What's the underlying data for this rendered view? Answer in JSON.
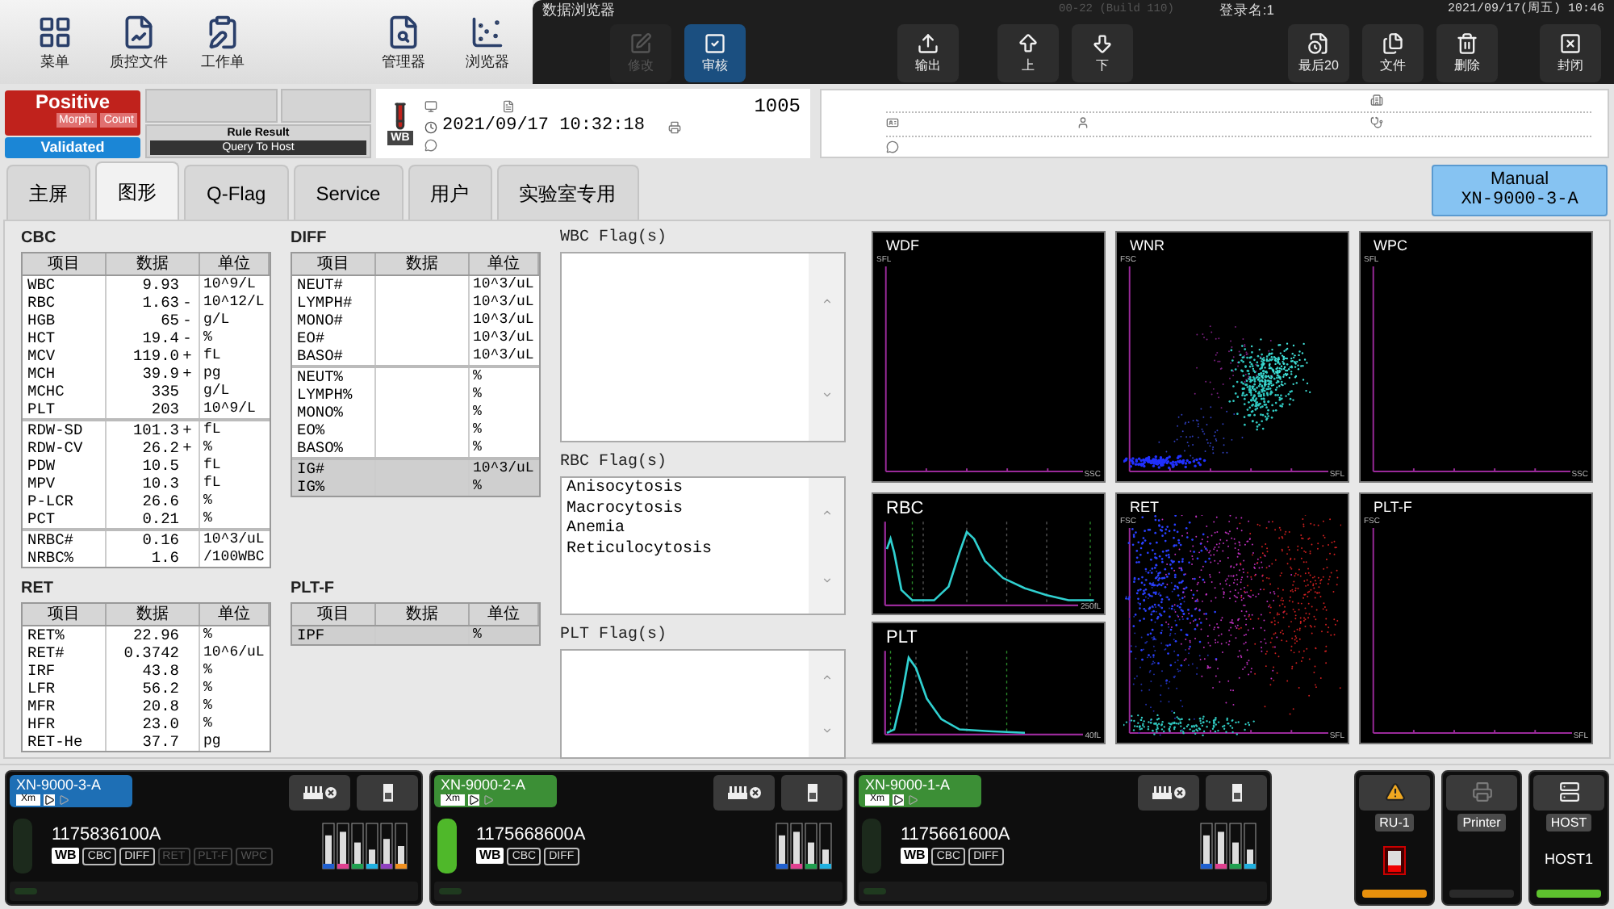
{
  "toolbar": [
    {
      "label": "菜单"
    },
    {
      "label": "质控文件"
    },
    {
      "label": "工作单"
    },
    {
      "label": "管理器"
    },
    {
      "label": "浏览器"
    }
  ],
  "browser": {
    "title": "数据浏览器",
    "build": "00-22 (Build 110)",
    "login": "登录名:1",
    "datetime": "2021/09/17(周五) 10:46",
    "groups": [
      [
        {
          "label": "修改",
          "disabled": true,
          "selected": false
        },
        {
          "label": "审核",
          "disabled": false,
          "selected": true
        }
      ],
      [
        {
          "label": "输出",
          "disabled": false,
          "selected": false
        }
      ],
      [
        {
          "label": "上",
          "disabled": false,
          "selected": false
        },
        {
          "label": "下",
          "disabled": false,
          "selected": false
        }
      ],
      [
        {
          "label": "最后20",
          "disabled": false,
          "selected": false
        },
        {
          "label": "文件",
          "disabled": false,
          "selected": false
        },
        {
          "label": "删除",
          "disabled": false,
          "selected": false
        }
      ],
      [
        {
          "label": "封闭",
          "disabled": false,
          "selected": false
        }
      ]
    ]
  },
  "status": {
    "result": "Positive",
    "tags": [
      "Morph.",
      "Count"
    ],
    "validation": "Validated",
    "rule_title": "Rule Result",
    "rule_value": "Query To Host"
  },
  "sample": {
    "type": "WB",
    "number": "1005",
    "datetime": "2021/09/17 10:32:18"
  },
  "tabs": [
    {
      "label": "主屏",
      "selected": false
    },
    {
      "label": "图形",
      "selected": true
    },
    {
      "label": "Q-Flag",
      "selected": false
    },
    {
      "label": "Service",
      "selected": false
    },
    {
      "label": "用户",
      "selected": false
    },
    {
      "label": "实验室专用",
      "selected": false
    }
  ],
  "mode_button": {
    "line1": "Manual",
    "line2": "XN-9000-3-A"
  },
  "left_tables": [
    {
      "title": "CBC",
      "columns": [
        "项目",
        "数据",
        "单位"
      ],
      "groups": [
        [
          {
            "item": "WBC",
            "value": "9.93",
            "unit": "10^9/L",
            "greyed": false
          },
          {
            "item": "RBC",
            "value": "1.63",
            "flag": "-",
            "unit": "10^12/L",
            "greyed": false
          },
          {
            "item": "HGB",
            "value": "65",
            "flag": "-",
            "unit": "g/L",
            "greyed": false
          },
          {
            "item": "HCT",
            "value": "19.4",
            "flag": "-",
            "unit": "%",
            "greyed": false
          },
          {
            "item": "MCV",
            "value": "119.0",
            "flag": "+",
            "unit": "fL",
            "greyed": false
          },
          {
            "item": "MCH",
            "value": "39.9",
            "flag": "+",
            "unit": "pg",
            "greyed": false
          },
          {
            "item": "MCHC",
            "value": "335",
            "unit": "g/L",
            "greyed": false
          },
          {
            "item": "PLT",
            "value": "203",
            "unit": "10^9/L",
            "greyed": false
          }
        ],
        [
          {
            "item": "RDW-SD",
            "value": "101.3",
            "flag": "+",
            "unit": "fL",
            "greyed": false
          },
          {
            "item": "RDW-CV",
            "value": "26.2",
            "flag": "+",
            "unit": "%",
            "greyed": false
          },
          {
            "item": "PDW",
            "value": "10.5",
            "unit": "fL",
            "greyed": false
          },
          {
            "item": "MPV",
            "value": "10.3",
            "unit": "fL",
            "greyed": false
          },
          {
            "item": "P-LCR",
            "value": "26.6",
            "unit": "%",
            "greyed": false
          },
          {
            "item": "PCT",
            "value": "0.21",
            "unit": "%",
            "greyed": false
          }
        ],
        [
          {
            "item": "NRBC#",
            "value": "0.16",
            "unit": "10^3/uL",
            "greyed": false
          },
          {
            "item": "NRBC%",
            "value": "1.6",
            "unit": "/100WBC",
            "greyed": false
          }
        ]
      ]
    },
    {
      "title": "RET",
      "columns": [
        "项目",
        "数据",
        "单位"
      ],
      "groups": [
        [
          {
            "item": "RET%",
            "value": "22.96",
            "unit": "%",
            "greyed": false
          },
          {
            "item": "RET#",
            "value": "0.3742",
            "unit": "10^6/uL",
            "greyed": false
          },
          {
            "item": "IRF",
            "value": "43.8",
            "unit": "%",
            "greyed": false
          },
          {
            "item": "LFR",
            "value": "56.2",
            "unit": "%",
            "greyed": false
          },
          {
            "item": "MFR",
            "value": "20.8",
            "unit": "%",
            "greyed": false
          },
          {
            "item": "HFR",
            "value": "23.0",
            "unit": "%",
            "greyed": false
          },
          {
            "item": "RET-He",
            "value": "37.7",
            "unit": "pg",
            "greyed": false
          }
        ]
      ]
    }
  ],
  "middle_tables": [
    {
      "title": "DIFF",
      "columns": [
        "项目",
        "数据",
        "单位"
      ],
      "groups": [
        [
          {
            "item": "NEUT#",
            "unit": "10^3/uL",
            "greyed": false
          },
          {
            "item": "LYMPH#",
            "unit": "10^3/uL",
            "greyed": false
          },
          {
            "item": "MONO#",
            "unit": "10^3/uL",
            "greyed": false
          },
          {
            "item": "EO#",
            "unit": "10^3/uL",
            "greyed": false
          },
          {
            "item": "BASO#",
            "unit": "10^3/uL",
            "greyed": false
          }
        ],
        [
          {
            "item": "NEUT%",
            "unit": "%",
            "greyed": false
          },
          {
            "item": "LYMPH%",
            "unit": "%",
            "greyed": false
          },
          {
            "item": "MONO%",
            "unit": "%",
            "greyed": false
          },
          {
            "item": "EO%",
            "unit": "%",
            "greyed": false
          },
          {
            "item": "BASO%",
            "unit": "%",
            "greyed": false
          }
        ],
        [
          {
            "item": "IG#",
            "unit": "10^3/uL",
            "greyed": true
          },
          {
            "item": "IG%",
            "unit": "%",
            "greyed": true
          }
        ]
      ]
    },
    {
      "title": "PLT-F",
      "columns": [
        "项目",
        "数据",
        "单位"
      ],
      "groups": [
        [
          {
            "item": "IPF",
            "unit": "%",
            "greyed": true
          }
        ]
      ]
    }
  ],
  "flags": [
    {
      "title": "WBC Flag(s)"
    },
    {
      "title": "RBC Flag(s)",
      "items": [
        "Anisocytosis",
        "Macrocytosis",
        "Anemia",
        "Reticulocytosis"
      ]
    },
    {
      "title": "PLT Flag(s)"
    }
  ],
  "graphs": {
    "top": [
      {
        "title": "WDF",
        "kind": "scatter-empty",
        "x_axis": "SSC",
        "y_axis": "SFL"
      },
      {
        "title": "WNR",
        "kind": "scatter-wnr",
        "x_axis": "SFL",
        "y_axis": "FSC"
      },
      {
        "title": "WPC",
        "kind": "scatter-empty",
        "x_axis": "SSC",
        "y_axis": "SFL"
      }
    ],
    "bottom_left": [
      {
        "title": "RBC",
        "kind": "histogram-rbc",
        "x_axis": "250fL"
      },
      {
        "title": "PLT",
        "kind": "histogram-plt",
        "x_axis": "40fL"
      }
    ],
    "bottom": [
      {
        "title": "RET",
        "kind": "scatter-ret",
        "x_axis": "SFL",
        "y_axis": "FSC"
      },
      {
        "title": "PLT-F",
        "kind": "scatter-empty",
        "x_axis": "SFL",
        "y_axis": "FSC"
      }
    ]
  },
  "analyzers": [
    {
      "name": "XN-9000-3-A",
      "color": "#1e6fb5",
      "mode": "Xm",
      "sample": "1175836100A",
      "type": "WB",
      "lit": false,
      "tests": [
        {
          "label": "CBC",
          "enabled": true
        },
        {
          "label": "DIFF",
          "enabled": true
        },
        {
          "label": "RET",
          "enabled": false
        },
        {
          "label": "PLT-F",
          "enabled": false
        },
        {
          "label": "WPC",
          "enabled": false
        }
      ]
    },
    {
      "name": "XN-9000-2-A",
      "color": "#3c8f36",
      "mode": "Xm",
      "sample": "1175668600A",
      "type": "WB",
      "lit": true,
      "tests": [
        {
          "label": "CBC",
          "enabled": true
        },
        {
          "label": "DIFF",
          "enabled": true
        }
      ]
    },
    {
      "name": "XN-9000-1-A",
      "color": "#3c8f36",
      "mode": "Xm",
      "sample": "1175661600A",
      "type": "WB",
      "lit": false,
      "tests": [
        {
          "label": "CBC",
          "enabled": true
        },
        {
          "label": "DIFF",
          "enabled": true
        }
      ]
    }
  ],
  "units": [
    {
      "label": "RU-1",
      "kind": "rack",
      "color": "#e8900c"
    },
    {
      "label": "Printer",
      "kind": "printer",
      "color": "#2a2a2a"
    },
    {
      "label": "HOST",
      "kind": "host",
      "value": "HOST1",
      "color": "#5ec22e"
    }
  ]
}
